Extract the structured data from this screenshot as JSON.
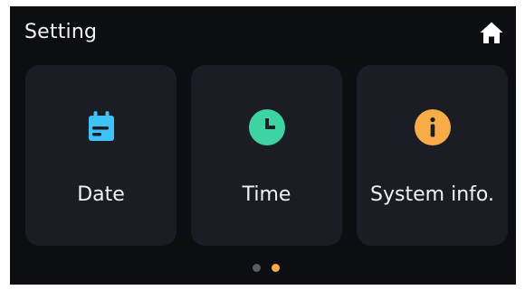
{
  "header": {
    "title": "Setting",
    "home_icon": "home-icon"
  },
  "cards": [
    {
      "label": "Date",
      "icon": "calendar-icon",
      "icon_color": "#3fc3f6"
    },
    {
      "label": "Time",
      "icon": "clock-icon",
      "icon_color": "#3ed3a3"
    },
    {
      "label": "System info.",
      "icon": "info-icon",
      "icon_color": "#f7ac47"
    }
  ],
  "colors": {
    "background": "#0d0e11",
    "card": "#1b1d24",
    "text": "#f2f2f2",
    "dot_inactive": "#5a5c62",
    "dot_active": "#f7ac47"
  },
  "pagination": {
    "total_pages": 2,
    "active_page": 2
  }
}
